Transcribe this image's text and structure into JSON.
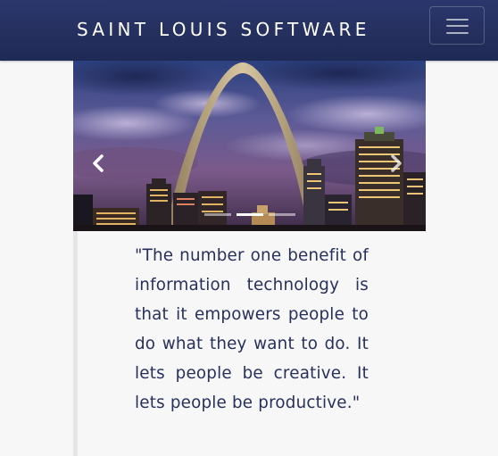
{
  "navbar": {
    "brand": "SAINT LOUIS SOFTWARE",
    "toggle_icon": "hamburger-menu-icon"
  },
  "carousel": {
    "prev_icon": "chevron-left-icon",
    "next_icon": "chevron-right-icon",
    "slide_count": 3,
    "active_slide": 2
  },
  "quote": {
    "text": "\"The number one benefit of information technology is that it empowers people to do what they want to do. It lets people be creative. It lets people be productive.\""
  },
  "colors": {
    "navbar": "#25305f",
    "quote_text": "#27305c",
    "background": "#f7f7f8"
  }
}
